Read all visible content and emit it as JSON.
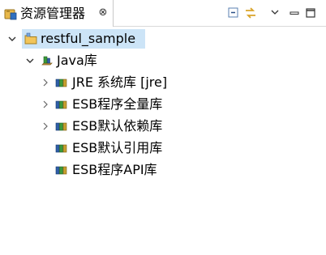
{
  "view": {
    "title": "资源管理器",
    "close_glyph": "⊗",
    "icon": "package-explorer-icon"
  },
  "toolbar": {
    "collapse_icon": "collapse-all-icon",
    "link_icon": "link-with-editor-icon",
    "menu_icon": "view-menu-icon",
    "minimize_icon": "minimize-icon",
    "maximize_icon": "maximize-icon"
  },
  "tree": {
    "project": {
      "label": "restful_sample",
      "expanded": true,
      "icon": "project-folder-icon"
    },
    "java_lib": {
      "label": "Java库",
      "expanded": true,
      "icon": "java-library-icon"
    },
    "libraries": [
      {
        "label": "JRE 系统库 [jre]",
        "expandable": true
      },
      {
        "label": "ESB程序全量库",
        "expandable": true
      },
      {
        "label": "ESB默认依赖库",
        "expandable": true
      },
      {
        "label": "ESB默认引用库",
        "expandable": false
      },
      {
        "label": "ESB程序API库",
        "expandable": false
      }
    ]
  },
  "colors": {
    "selection": "#cce4f7",
    "folder": "#e8b84a",
    "jar_blue": "#2f5fa8",
    "jar_green": "#3a9a3a"
  }
}
